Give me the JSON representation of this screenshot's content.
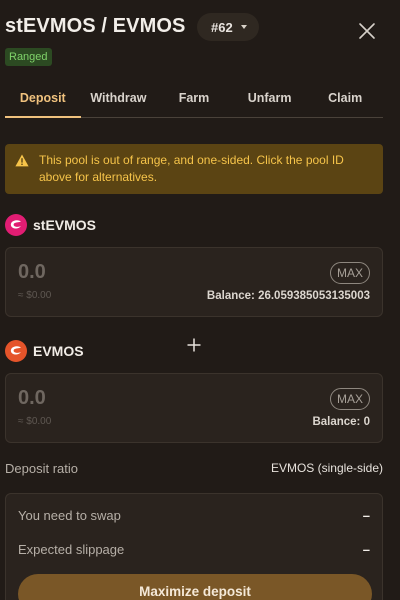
{
  "header": {
    "title": "stEVMOS / EVMOS",
    "pool_id": "#62",
    "status_badge": "Ranged"
  },
  "tabs": [
    {
      "label": "Deposit",
      "active": true
    },
    {
      "label": "Withdraw",
      "active": false
    },
    {
      "label": "Farm",
      "active": false
    },
    {
      "label": "Unfarm",
      "active": false
    },
    {
      "label": "Claim",
      "active": false
    }
  ],
  "warning": {
    "text": "This pool is out of range, and one-sided. Click the pool ID above for alternatives."
  },
  "token_a": {
    "symbol": "stEVMOS",
    "amount": "0.0",
    "usd": "≈ $0.00",
    "max_label": "MAX",
    "balance_label": "Balance:",
    "balance_value": "26.059385053135003"
  },
  "token_b": {
    "symbol": "EVMOS",
    "amount": "0.0",
    "usd": "≈ $0.00",
    "max_label": "MAX",
    "balance_label": "Balance:",
    "balance_value": "0"
  },
  "ratio": {
    "label": "Deposit ratio",
    "value": "EVMOS (single-side)"
  },
  "summary": {
    "swap_label": "You need to swap",
    "swap_value": "–",
    "slippage_label": "Expected slippage",
    "slippage_value": "–",
    "button_label": "Maximize deposit"
  },
  "icons": {
    "close": "close-icon",
    "warning": "warning-icon",
    "caret": "chevron-down-icon",
    "plus": "plus-icon"
  },
  "colors": {
    "background": "#211b17",
    "accent": "#f0c27e",
    "warning_bg": "#5b4413",
    "warning_text": "#f6c44a",
    "badge_bg": "#2c4a22",
    "badge_text": "#7fd36a",
    "stevmos": "#e11d73",
    "evmos": "#e5542a",
    "button": "#7a5727"
  }
}
